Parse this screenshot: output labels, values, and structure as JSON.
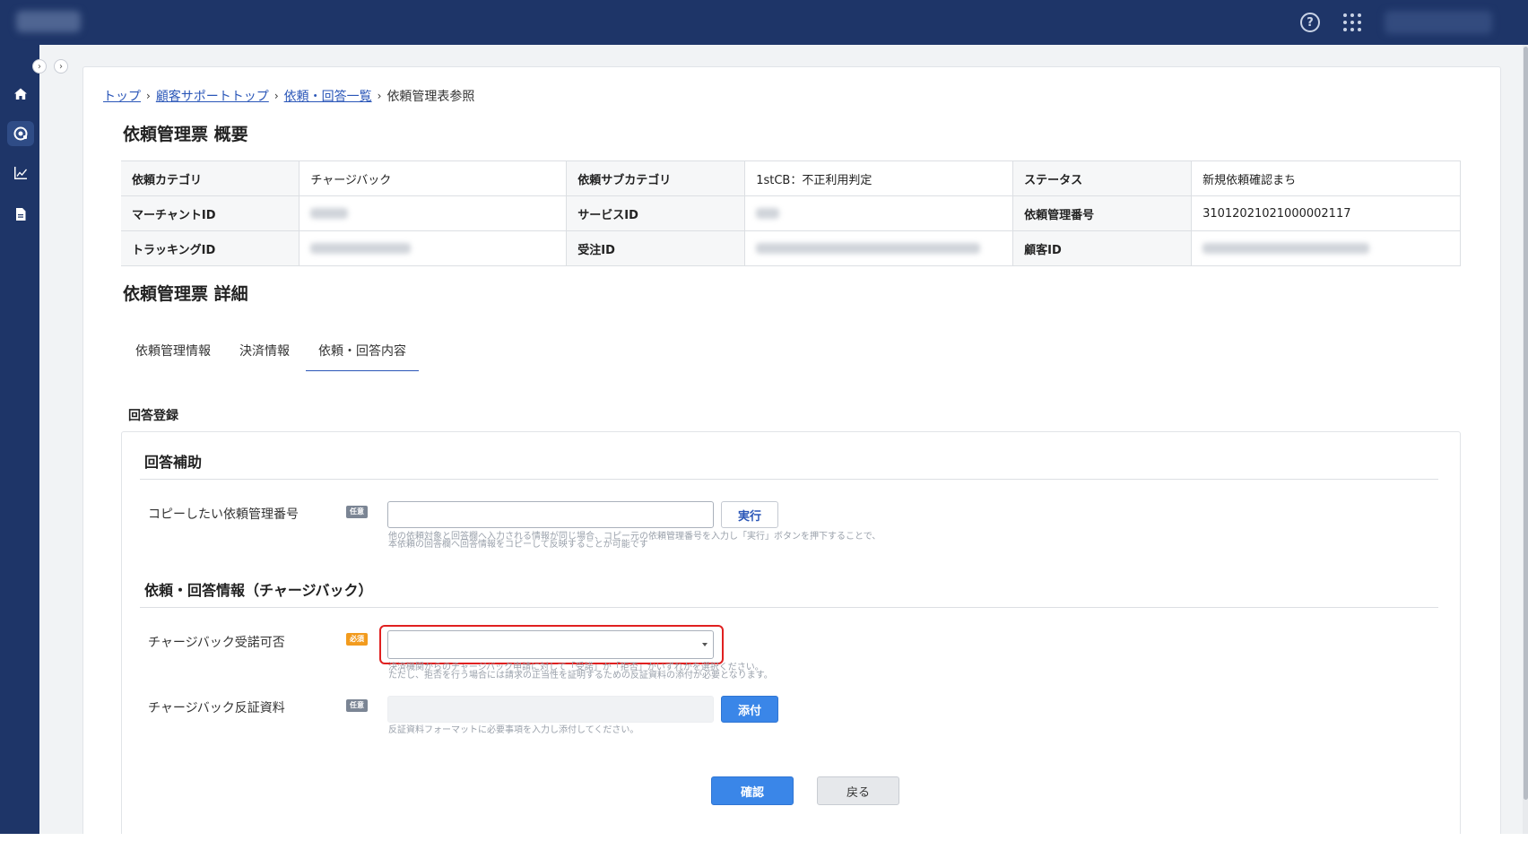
{
  "header": {
    "help_icon": "help-circle-icon",
    "apps_icon": "apps-grid-icon"
  },
  "sidebar": {
    "items": [
      {
        "icon": "home-icon"
      },
      {
        "icon": "support-icon",
        "active": true
      },
      {
        "icon": "chart-icon"
      },
      {
        "icon": "document-icon"
      }
    ]
  },
  "breadcrumb": {
    "items": [
      "トップ",
      "顧客サポートトップ",
      "依頼・回答一覧"
    ],
    "current": "依頼管理表参照"
  },
  "summary": {
    "title": "依頼管理票 概要",
    "rows": [
      [
        {
          "label": "依頼カテゴリ",
          "value": "チャージバック"
        },
        {
          "label": "依頼サブカテゴリ",
          "value": "1stCB：不正利用判定"
        },
        {
          "label": "ステータス",
          "value": "新規依頼確認まち"
        }
      ],
      [
        {
          "label": "マーチャントID",
          "value": ""
        },
        {
          "label": "サービスID",
          "value": ""
        },
        {
          "label": "依頼管理番号",
          "value": "31012021021000002117"
        }
      ],
      [
        {
          "label": "トラッキングID",
          "value": ""
        },
        {
          "label": "受注ID",
          "value": ""
        },
        {
          "label": "顧客ID",
          "value": ""
        }
      ]
    ]
  },
  "detail": {
    "title": "依頼管理票 詳細",
    "tabs": [
      "依頼管理情報",
      "決済情報",
      "依頼・回答内容"
    ],
    "active_tab": 2
  },
  "form": {
    "section_title": "回答登録",
    "assist": {
      "title": "回答補助",
      "copy_label": "コピーしたい依頼管理番号",
      "copy_badge": "任意",
      "copy_value": "",
      "exec_label": "実行",
      "help_line1": "他の依頼対象と回答欄へ入力される情報が同じ場合、コピー元の依頼管理番号を入力し「実行」ボタンを押下することで、",
      "help_line2": "本依頼の回答欄へ回答情報をコピーして反映することが可能です"
    },
    "info": {
      "title": "依頼・回答情報（チャージバック）",
      "accept_label": "チャージバック受諾可否",
      "accept_badge": "必須",
      "accept_value": "",
      "accept_help_line1": "決済機関からのチャージバック申請に対して「受諾」か「拒否」かいずれかを選択ください。",
      "accept_help_line2": "ただし、拒否を行う場合には請求の正当性を証明するための反証資料の添付が必要となります。",
      "evidence_label": "チャージバック反証資料",
      "evidence_badge": "任意",
      "attach_label": "添付",
      "evidence_help": "反証資料フォーマットに必要事項を入力し添付してください。"
    },
    "confirm_label": "確認",
    "back_label": "戻る"
  }
}
